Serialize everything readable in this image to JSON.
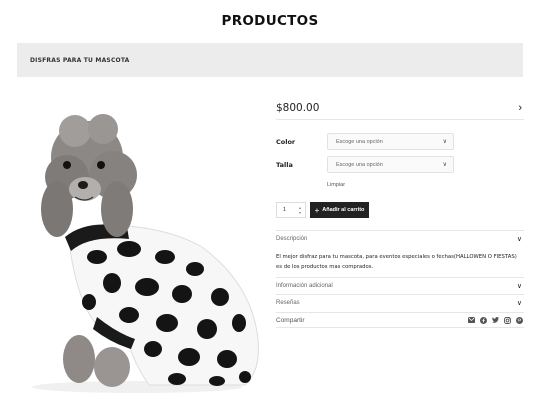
{
  "header": {
    "title": "PRODUCTOS"
  },
  "breadcrumb": {
    "text": "DISFRAS PARA TU MASCOTA"
  },
  "product": {
    "price": "$800.00",
    "options": [
      {
        "label": "Color",
        "placeholder": "Escoge una opción"
      },
      {
        "label": "Talla",
        "placeholder": "Escoge una opción"
      }
    ],
    "clear_label": "Limpiar",
    "quantity": "1",
    "add_to_cart_label": "Añadir al carrito",
    "add_to_cart_icon": "+"
  },
  "tabs": {
    "description_label": "Descripción",
    "description_text": "El mejor disfraz para tu mascota, para eventos especiales o fechas(HALLOWEN O FIESTAS) es de los productos mas comprados.",
    "additional_label": "Información adicional",
    "reviews_label": "Reseñas"
  },
  "share": {
    "label": "Compartir",
    "icons": [
      "email-icon",
      "facebook-icon",
      "twitter-icon",
      "instagram-icon",
      "pinterest-icon"
    ]
  },
  "colors": {
    "button_bg": "#222222",
    "crumb_bg": "#ececec"
  }
}
